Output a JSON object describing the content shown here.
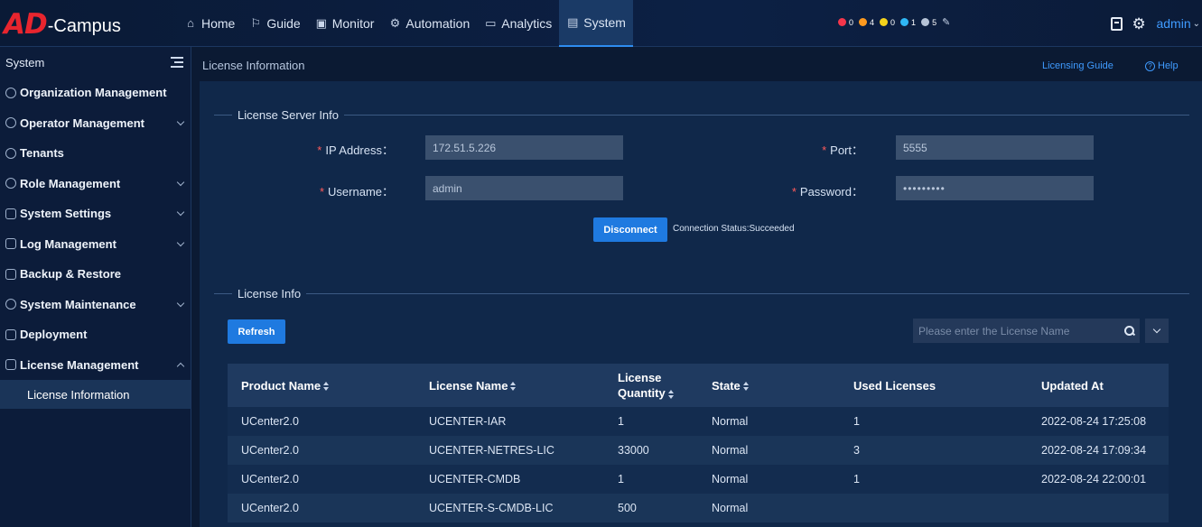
{
  "header": {
    "logo_mark": "AD",
    "logo_text": "-Campus",
    "nav": [
      {
        "label": "Home",
        "icon": "home-icon"
      },
      {
        "label": "Guide",
        "icon": "signpost-icon"
      },
      {
        "label": "Monitor",
        "icon": "monitor-icon"
      },
      {
        "label": "Automation",
        "icon": "automation-icon"
      },
      {
        "label": "Analytics",
        "icon": "analytics-icon"
      },
      {
        "label": "System",
        "icon": "system-icon",
        "active": true
      }
    ],
    "alarms": [
      {
        "count": "0",
        "color": "#f5364b"
      },
      {
        "count": "4",
        "color": "#ff9a1f"
      },
      {
        "count": "0",
        "color": "#f5d21b"
      },
      {
        "count": "1",
        "color": "#2fb7f5"
      },
      {
        "count": "5",
        "color": "#b6c3d6"
      }
    ],
    "user": "admin"
  },
  "sidebar": {
    "title": "System",
    "items": [
      {
        "label": "Organization Management",
        "icon": "organization-icon",
        "expandable": false
      },
      {
        "label": "Operator Management",
        "icon": "operator-icon",
        "expandable": true
      },
      {
        "label": "Tenants",
        "icon": "tenant-icon",
        "expandable": false
      },
      {
        "label": "Role Management",
        "icon": "role-icon",
        "expandable": true
      },
      {
        "label": "System Settings",
        "icon": "settings-icon",
        "expandable": true
      },
      {
        "label": "Log Management",
        "icon": "log-icon",
        "expandable": true
      },
      {
        "label": "Backup & Restore",
        "icon": "backup-icon",
        "expandable": false
      },
      {
        "label": "System Maintenance",
        "icon": "maintenance-icon",
        "expandable": true
      },
      {
        "label": "Deployment",
        "icon": "deployment-icon",
        "expandable": false
      },
      {
        "label": "License Management",
        "icon": "license-icon",
        "expandable": true,
        "expanded": true
      }
    ],
    "active_sub_item": "License Information"
  },
  "main": {
    "title": "License Information",
    "licensing_guide": "Licensing Guide",
    "help": "Help",
    "server_section": "License Server Info",
    "form": {
      "ip_label": "IP Address：",
      "ip_value": "172.51.5.226",
      "port_label": "Port：",
      "port_value": "5555",
      "username_label": "Username：",
      "username_value": "admin",
      "password_label": "Password：",
      "password_value": "•••••••••"
    },
    "disconnect_button": "Disconnect",
    "connection_status": "Connection Status:Succeeded",
    "license_section": "License Info",
    "refresh_button": "Refresh",
    "search_placeholder": "Please enter the License Name",
    "table": {
      "columns": [
        {
          "label": "Product Name",
          "sortable": true
        },
        {
          "label": "License Name",
          "sortable": true
        },
        {
          "label": "License Quantity",
          "sortable": true
        },
        {
          "label": "State",
          "sortable": true
        },
        {
          "label": "Used Licenses",
          "sortable": false
        },
        {
          "label": "Updated At",
          "sortable": false
        }
      ],
      "rows": [
        [
          "UCenter2.0",
          "UCENTER-IAR",
          "1",
          "Normal",
          "1",
          "2022-08-24 17:25:08"
        ],
        [
          "UCenter2.0",
          "UCENTER-NETRES-LIC",
          "33000",
          "Normal",
          "3",
          "2022-08-24 17:09:34"
        ],
        [
          "UCenter2.0",
          "UCENTER-CMDB",
          "1",
          "Normal",
          "1",
          "2022-08-24 22:00:01"
        ],
        [
          "UCenter2.0",
          "UCENTER-S-CMDB-LIC",
          "500",
          "Normal",
          "",
          ""
        ]
      ]
    }
  }
}
